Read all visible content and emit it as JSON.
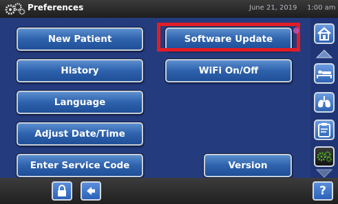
{
  "header": {
    "title": "Preferences",
    "date": "June 21, 2019",
    "time": "1:00 am",
    "icon": "gears-icon"
  },
  "menu": {
    "new_patient": "New Patient",
    "history": "History",
    "language": "Language",
    "adjust_date_time": "Adjust Date/Time",
    "enter_service_code": "Enter Service Code",
    "software_update": "Software Update",
    "wifi": "WiFi On/Off",
    "version": "Version"
  },
  "sidebar": {
    "items": [
      "home-icon",
      "patient-bed-icon",
      "lungs-icon",
      "clipboard-icon",
      "gears-icon"
    ],
    "active": "gears-icon"
  },
  "footer": {
    "help_label": "?",
    "icons": [
      "lock-icon",
      "back-arrow-icon"
    ]
  },
  "colors": {
    "panel_bg": "#243b7e",
    "button_top": "#5b8fcf",
    "highlight": "#e21d25",
    "notification_dot": "#b84ca0"
  }
}
